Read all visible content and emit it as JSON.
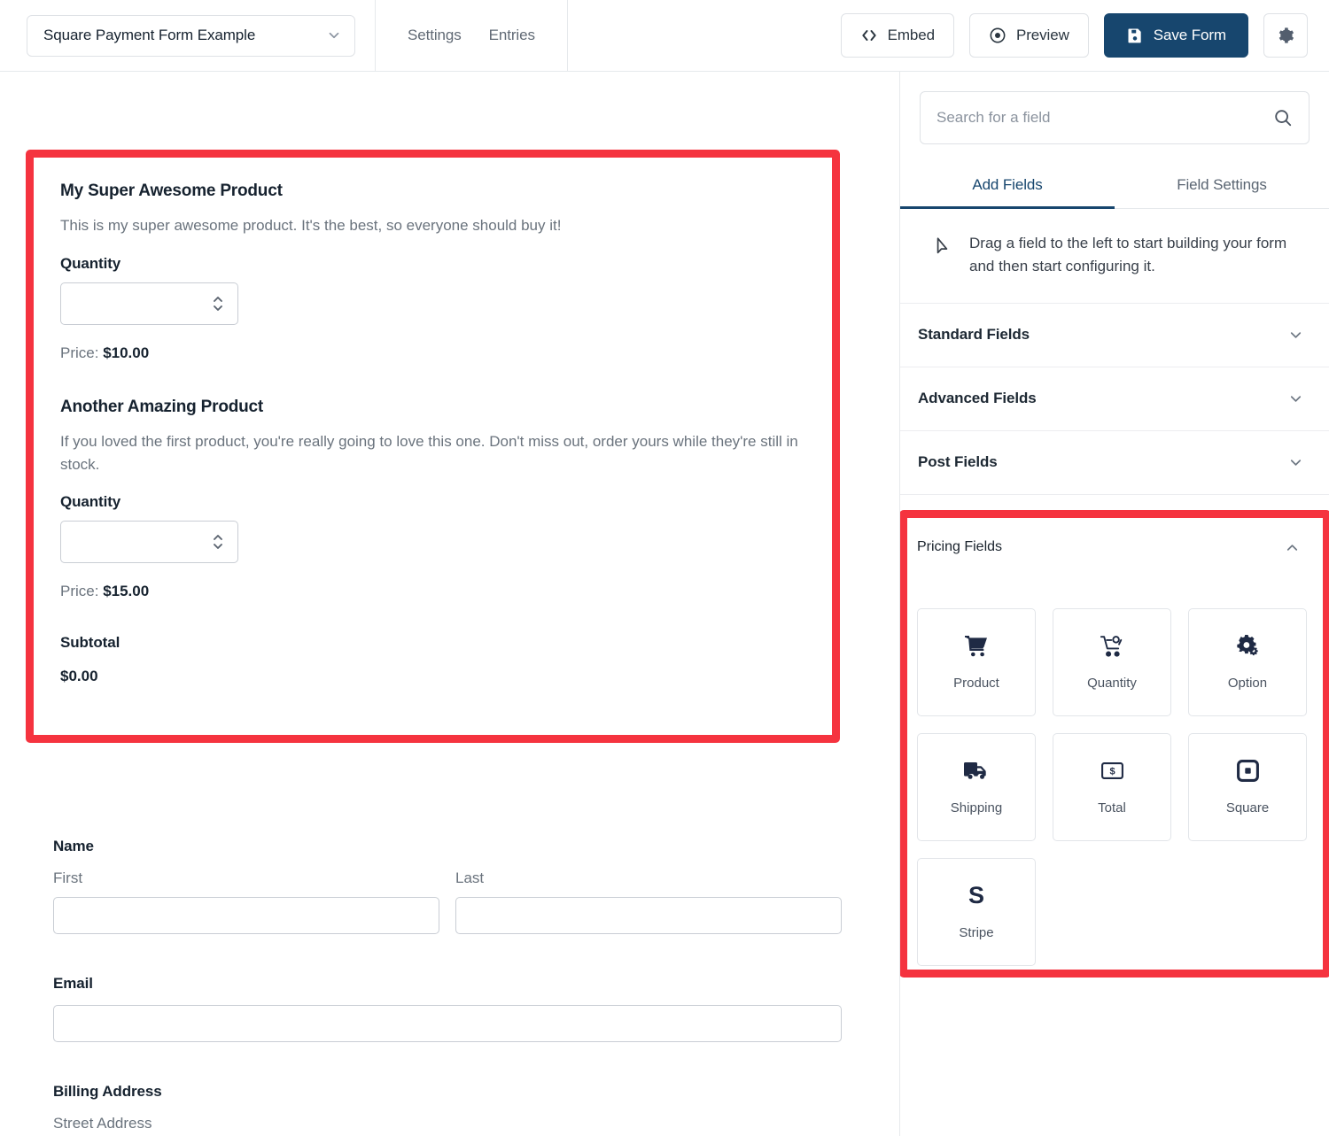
{
  "topbar": {
    "form_name": "Square Payment Form Example",
    "chevron_icon": "chevron-down-icon",
    "tabs": [
      {
        "label": "Settings"
      },
      {
        "label": "Entries"
      }
    ],
    "actions": [
      {
        "label": "Embed",
        "icon": "code-icon"
      },
      {
        "label": "Preview",
        "icon": "eye-icon"
      },
      {
        "label": "Save Form",
        "icon": "save-disk-icon"
      }
    ],
    "settings_icon": "gear-icon",
    "primary_color": "#17466e"
  },
  "preview": {
    "annotation_color": "#f5333f",
    "products": [
      {
        "title": "My Super Awesome Product",
        "description": "This is my super awesome product. It's the best, so everyone should buy it!",
        "quantity_label": "Quantity",
        "quantity_value": "",
        "price_prefix": "Price: ",
        "price": "$10.00"
      },
      {
        "title": "Another Amazing Product",
        "description": "If you loved the first product, you're really going to love this one. Don't miss out, order yours while they're still in stock.",
        "quantity_label": "Quantity",
        "quantity_value": "",
        "price_prefix": "Price: ",
        "price": "$15.00"
      }
    ],
    "subtotal_label": "Subtotal",
    "subtotal_value": "$0.00",
    "name_section": {
      "heading": "Name",
      "first_label": "First",
      "first_value": "",
      "last_label": "Last",
      "last_value": ""
    },
    "email_section": {
      "heading": "Email",
      "value": ""
    },
    "billing_section": {
      "heading": "Billing Address",
      "street_label": "Street Address"
    }
  },
  "sidebar": {
    "search": {
      "placeholder": "Search for a field",
      "value": "",
      "icon": "search-icon"
    },
    "tabs": [
      {
        "label": "Add Fields",
        "active": true
      },
      {
        "label": "Field Settings",
        "active": false
      }
    ],
    "drag_hint": {
      "icon": "cursor-arrow-icon",
      "text": "Drag a field to the left to start building your form and then start configuring it."
    },
    "groups": [
      {
        "label": "Standard Fields",
        "expanded": false,
        "icon": "chevron-down-icon"
      },
      {
        "label": "Advanced Fields",
        "expanded": false,
        "icon": "chevron-down-icon"
      },
      {
        "label": "Post Fields",
        "expanded": false,
        "icon": "chevron-down-icon"
      }
    ],
    "pricing_group": {
      "label": "Pricing Fields",
      "expanded": true,
      "icon": "chevron-up-icon",
      "tiles": [
        {
          "label": "Product",
          "icon": "shopping-cart-icon"
        },
        {
          "label": "Quantity",
          "icon": "cart-quantity-icon"
        },
        {
          "label": "Option",
          "icon": "gears-icon"
        },
        {
          "label": "Shipping",
          "icon": "truck-icon"
        },
        {
          "label": "Total",
          "icon": "money-bill-icon"
        },
        {
          "label": "Square",
          "icon": "square-logo-icon"
        },
        {
          "label": "Stripe",
          "icon": "stripe-logo-icon"
        }
      ]
    }
  }
}
